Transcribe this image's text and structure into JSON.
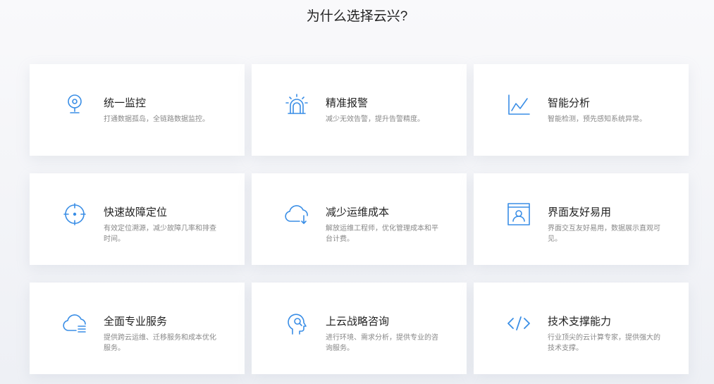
{
  "section": {
    "heading": "为什么选择云兴?"
  },
  "features": [
    {
      "title": "统一监控",
      "desc": "打通数据孤岛，全链路数据监控。",
      "icon": "webcam-icon"
    },
    {
      "title": "精准报警",
      "desc": "减少无效告警，提升告警精度。",
      "icon": "siren-icon"
    },
    {
      "title": "智能分析",
      "desc": "智能检测，预先感知系统异常。",
      "icon": "line-chart-icon"
    },
    {
      "title": "快速故障定位",
      "desc": "有效定位溯源，减少故障几率和排查时间。",
      "icon": "crosshair-icon"
    },
    {
      "title": "减少运维成本",
      "desc": "解放运维工程师，优化管理成本和平台计费。",
      "icon": "cloud-download-icon"
    },
    {
      "title": "界面友好易用",
      "desc": "界面交互友好易用，数据展示直观可见。",
      "icon": "user-window-icon"
    },
    {
      "title": "全面专业服务",
      "desc": "提供跨云运维、迁移服务和成本优化服务。",
      "icon": "cloud-list-icon"
    },
    {
      "title": "上云战略咨询",
      "desc": "进行环境、需求分析，提供专业的咨询服务。",
      "icon": "head-search-icon"
    },
    {
      "title": "技术支撑能力",
      "desc": "行业顶尖的云计算专家，提供强大的技术支撑。",
      "icon": "code-icon"
    }
  ],
  "colors": {
    "accent": "#3a8ee6",
    "title": "#222222",
    "desc": "#888888"
  }
}
